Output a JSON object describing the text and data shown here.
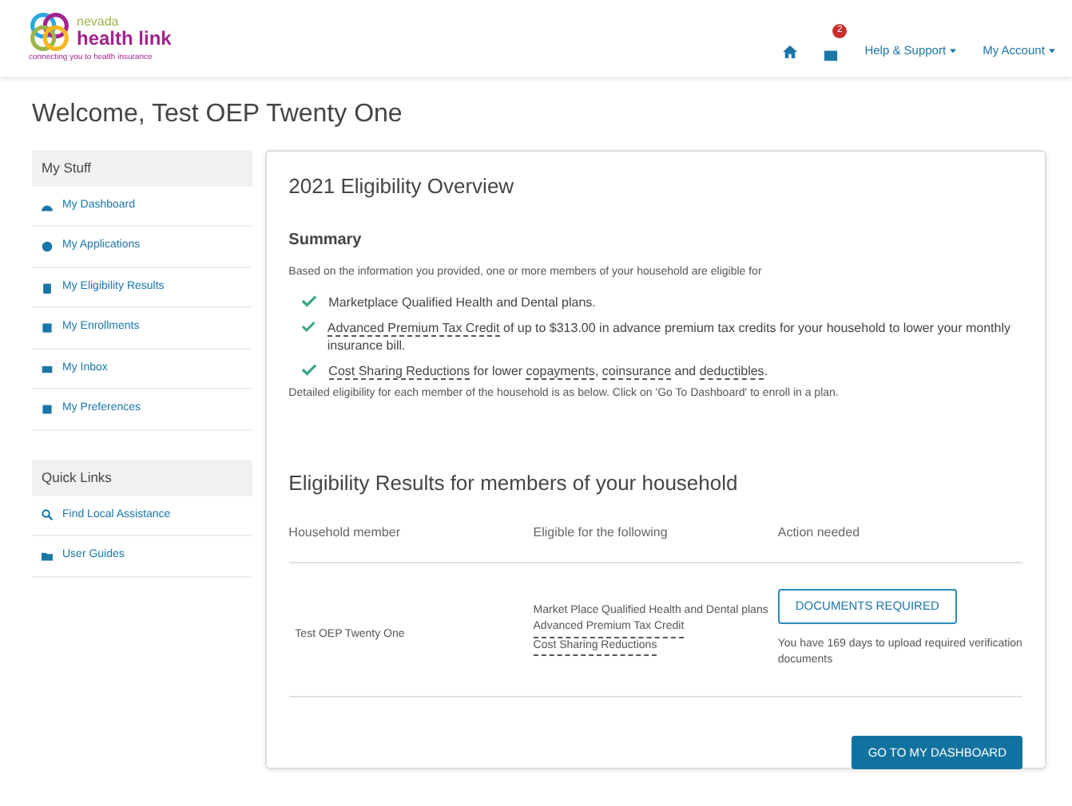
{
  "header": {
    "logo_small": "nevada",
    "logo_big": "health link",
    "tagline": "connecting you to health insurance",
    "inbox_badge": "2",
    "menus": [
      "Help & Support",
      "My Account"
    ]
  },
  "page_title": "Welcome, Test OEP Twenty One",
  "sidebar": {
    "sections": [
      {
        "heading": "My Stuff",
        "items": [
          {
            "label": "My Dashboard"
          },
          {
            "label": "My Applications"
          },
          {
            "label": "My Eligibility Results"
          },
          {
            "label": "My Enrollments"
          },
          {
            "label": "My Inbox"
          },
          {
            "label": "My Preferences"
          }
        ]
      },
      {
        "heading": "Quick Links",
        "items": [
          {
            "label": "Find Local Assistance"
          },
          {
            "label": "User Guides"
          }
        ]
      }
    ]
  },
  "overview": {
    "title": "2021 Eligibility Overview",
    "summary_heading": "Summary",
    "intro": "Based on the information you provided, one or more members of your household are eligible for",
    "bullets": [
      [
        {
          "text": "Marketplace Qualified Health and Dental plans.",
          "term": false
        }
      ],
      [
        {
          "text": "Advanced Premium Tax Credit",
          "term": true
        },
        {
          "text": " of up to $313.00 in advance premium tax credits for your household to lower your monthly insurance bill.",
          "term": false
        }
      ],
      [
        {
          "text": "Cost Sharing Reductions",
          "term": true
        },
        {
          "text": " for lower ",
          "term": false
        },
        {
          "text": "copayments",
          "term": true
        },
        {
          "text": ", ",
          "term": false
        },
        {
          "text": "coinsurance",
          "term": true
        },
        {
          "text": " and ",
          "term": false
        },
        {
          "text": "deductibles",
          "term": true
        },
        {
          "text": ".",
          "term": false
        }
      ]
    ],
    "detail": "Detailed eligibility for each member of the household is as below. Click on 'Go To Dashboard' to enroll in a plan."
  },
  "results": {
    "title": "Eligibility Results for members of your household",
    "columns": [
      "Household member",
      "Eligible for the following",
      "Action needed"
    ],
    "rows": [
      {
        "member": "Test OEP Twenty One",
        "eligible": [
          {
            "text": "Market Place Qualified Health and Dental plans",
            "term": false
          },
          {
            "text": "Advanced Premium Tax Credit",
            "term": true
          },
          {
            "text": "Cost Sharing Reductions",
            "term": true
          }
        ],
        "action_button": "DOCUMENTS REQUIRED",
        "action_note": "You have 169 days to upload required verification documents"
      }
    ]
  },
  "dashboard_button": "GO TO MY DASHBOARD"
}
